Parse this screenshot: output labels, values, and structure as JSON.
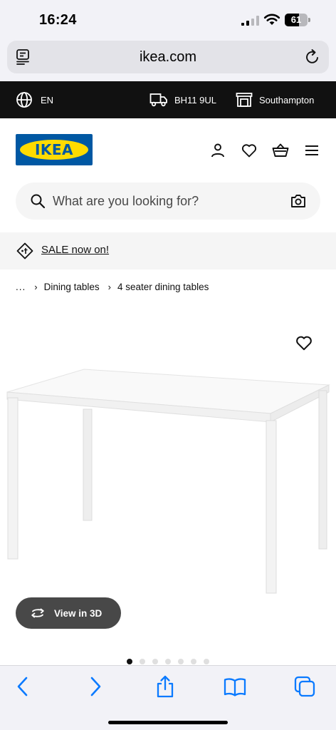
{
  "status_bar": {
    "time": "16:24",
    "battery_text": "61",
    "battery_level": 0.61
  },
  "browser": {
    "url": "ikea.com"
  },
  "topbar": {
    "language": "EN",
    "postcode": "BH11 9UL",
    "store": "Southampton"
  },
  "header": {
    "logo_text": "IKEA",
    "icons": [
      "account-icon",
      "heart-icon",
      "basket-icon",
      "menu-icon"
    ]
  },
  "search": {
    "placeholder": "What are you looking for?"
  },
  "promo": {
    "label": "SALE now on!"
  },
  "breadcrumb": {
    "ellipsis": "...",
    "items": [
      "Dining tables",
      "4 seater dining tables"
    ]
  },
  "product": {
    "view_3d_label": "View in 3D"
  },
  "carousel": {
    "count": 7,
    "active_index": 0
  },
  "colors": {
    "ikea_blue": "#0058a3",
    "ikea_yellow": "#ffdb00",
    "topbar_bg": "#111111",
    "safari_blue": "#0a7aff",
    "button_grey": "#484848"
  }
}
